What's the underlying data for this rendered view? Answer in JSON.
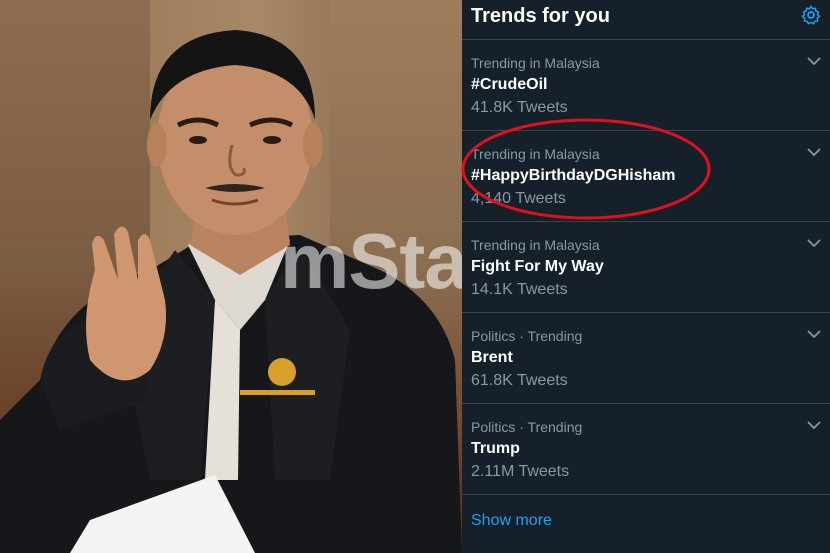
{
  "photo": {
    "watermark": "mStar",
    "subject": "man-waving-photo"
  },
  "trends": {
    "title": "Trends for you",
    "settings_icon": "gear-icon",
    "items": [
      {
        "context": "Trending in Malaysia",
        "name": "#CrudeOil",
        "count": "41.8K Tweets"
      },
      {
        "context": "Trending in Malaysia",
        "name": "#HappyBirthdayDGHisham",
        "count": "4,140 Tweets"
      },
      {
        "context": "Trending in Malaysia",
        "name": "Fight For My Way",
        "count": "14.1K Tweets"
      },
      {
        "context": "Politics · Trending",
        "name": "Brent",
        "count": "61.8K Tweets"
      },
      {
        "context": "Politics · Trending",
        "name": "Trump",
        "count": "2.11M Tweets"
      }
    ],
    "show_more": "Show more"
  },
  "colors": {
    "panel_bg": "#15202b",
    "divider": "#38444d",
    "secondary_text": "#8899a6",
    "accent": "#1da1f2",
    "highlight_ring": "#e0101e"
  }
}
